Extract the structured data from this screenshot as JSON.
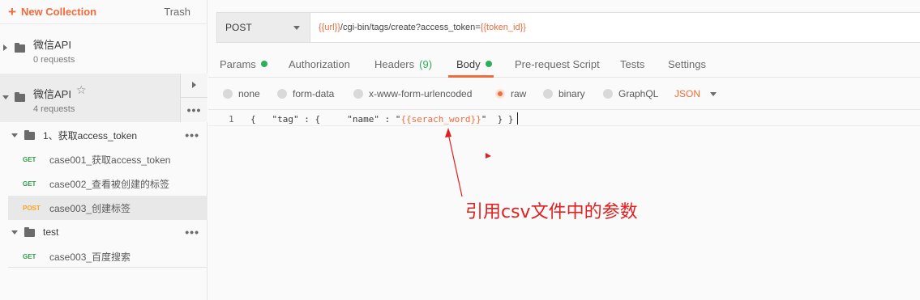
{
  "sidebar": {
    "new_collection": "New Collection",
    "trash": "Trash",
    "collections": [
      {
        "name": "微信API",
        "count": "0 requests"
      },
      {
        "name": "微信API",
        "count": "4 requests"
      }
    ],
    "folders": [
      {
        "name": "1、获取access_token"
      },
      {
        "name": "test"
      }
    ],
    "requests": [
      {
        "method": "GET",
        "name": "case001_获取access_token"
      },
      {
        "method": "GET",
        "name": "case002_查看被创建的标签"
      },
      {
        "method": "POST",
        "name": "case003_创建标签"
      },
      {
        "method": "GET",
        "name": "case003_百度搜索"
      }
    ],
    "more": "•••",
    "star": "☆"
  },
  "request": {
    "method": "POST",
    "url_parts": {
      "var1": "{{url}}",
      "path": "/cgi-bin/tags/create?access_token=",
      "var2": "{{token_id}}"
    }
  },
  "tabs": {
    "params": "Params",
    "authorization": "Authorization",
    "headers": "Headers",
    "headers_count": "(9)",
    "body": "Body",
    "prerequest": "Pre-request Script",
    "tests": "Tests",
    "settings": "Settings"
  },
  "body_options": {
    "none": "none",
    "form_data": "form-data",
    "urlencoded": "x-www-form-urlencoded",
    "raw": "raw",
    "binary": "binary",
    "graphql": "GraphQL",
    "format": "JSON",
    "selected": "raw"
  },
  "editor": {
    "line_number": "1",
    "code_prefix": "{   \"tag\" : {     \"name\" : \"",
    "code_var": "{{serach_word}}",
    "code_suffix": "\"  } }"
  },
  "annotation": {
    "text": "引用csv文件中的参数",
    "color": "#e0201f"
  },
  "colors": {
    "accent": "#f26b3a",
    "get": "#2e9c46",
    "post": "#f5a623",
    "status_dot": "#2cae5b"
  }
}
